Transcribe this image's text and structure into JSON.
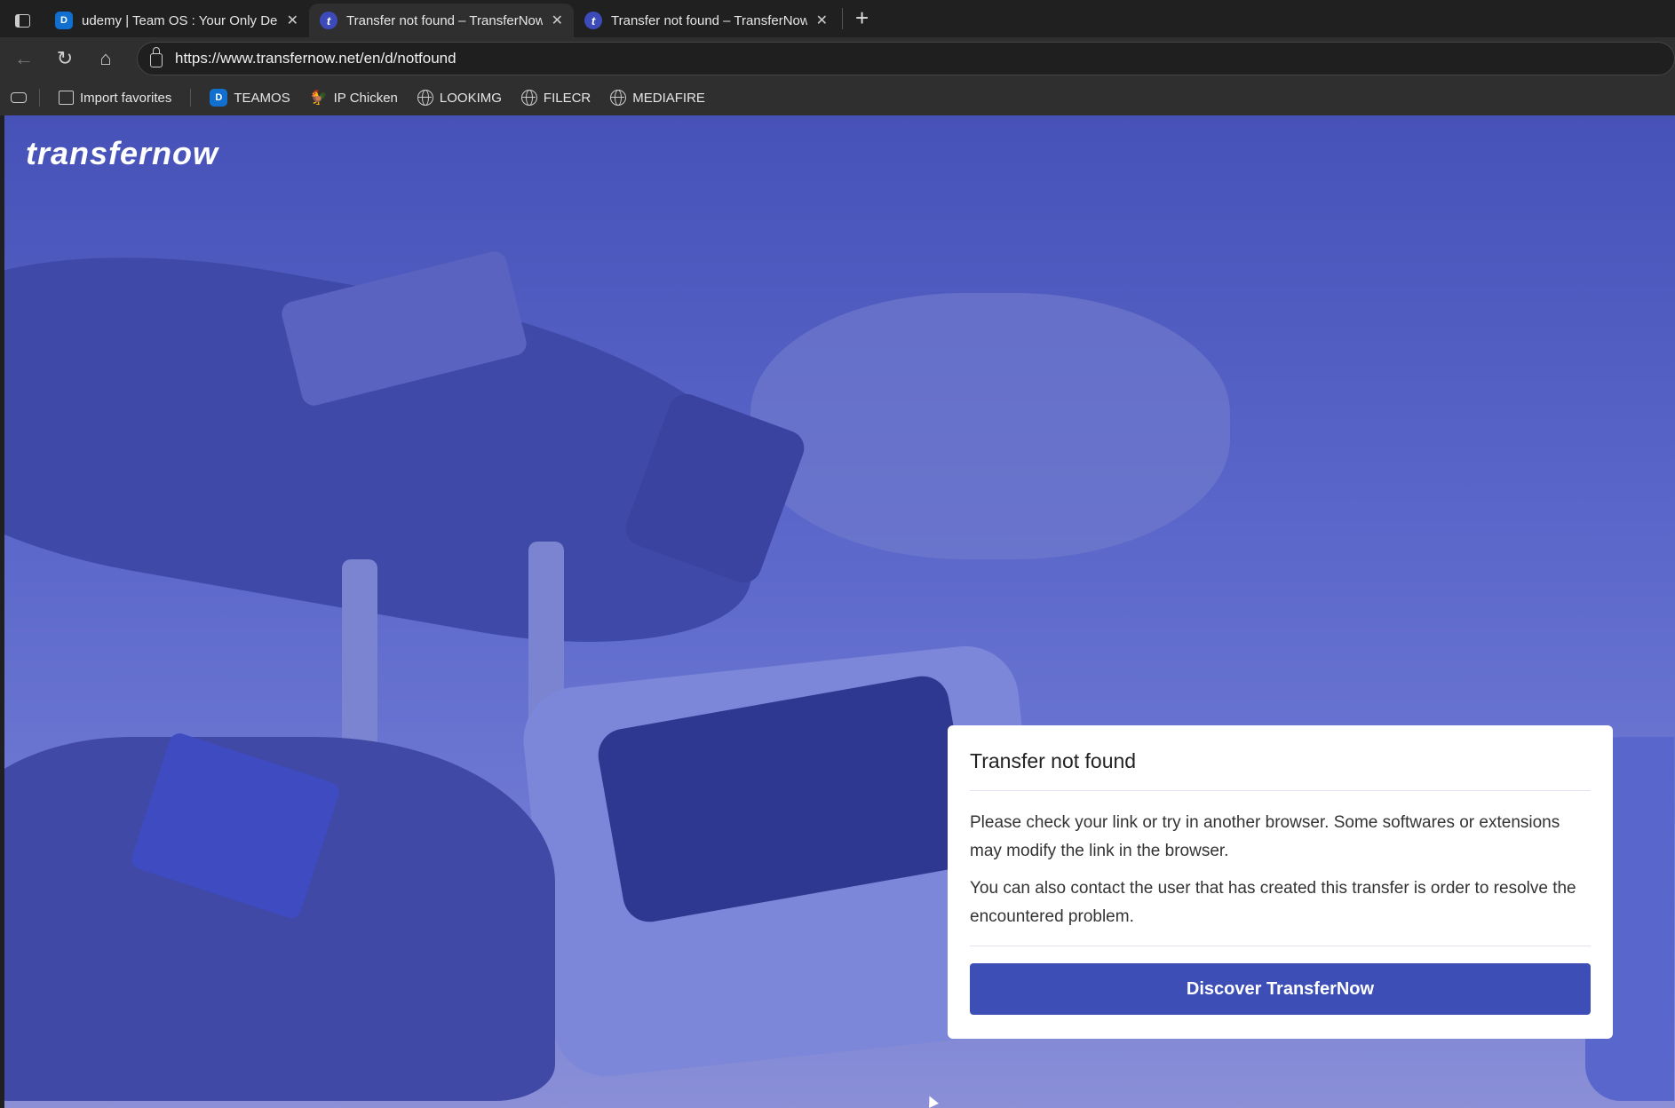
{
  "browser": {
    "tabs": [
      {
        "title": "udemy | Team OS : Your Only Destination",
        "favicon": "teamos-icon",
        "active": false
      },
      {
        "title": "Transfer not found – TransferNow",
        "favicon": "t",
        "active": true
      },
      {
        "title": "Transfer not found – TransferNow",
        "favicon": "t",
        "active": false
      }
    ],
    "close_glyph": "✕",
    "new_tab_glyph": "+",
    "url": "https://www.transfernow.net/en/d/notfound",
    "bookmarks": [
      {
        "label": "Import favorites",
        "icon": "import-icon"
      },
      {
        "label": "TEAMOS",
        "icon": "teamos-icon"
      },
      {
        "label": "IP Chicken",
        "icon": "chicken-icon"
      },
      {
        "label": "LOOKIMG",
        "icon": "globe-icon"
      },
      {
        "label": "FILECR",
        "icon": "globe-icon"
      },
      {
        "label": "MEDIAFIRE",
        "icon": "globe-icon"
      }
    ]
  },
  "page": {
    "logo": "transfernow",
    "card": {
      "title": "Transfer not found",
      "paragraph1": "Please check your link or try in another browser. Some softwares or extensions may modify the link in the browser.",
      "paragraph2": "You can also contact the user that has created this transfer is order to resolve the encountered problem.",
      "button": "Discover TransferNow"
    },
    "accent": "#3d4fb6"
  }
}
